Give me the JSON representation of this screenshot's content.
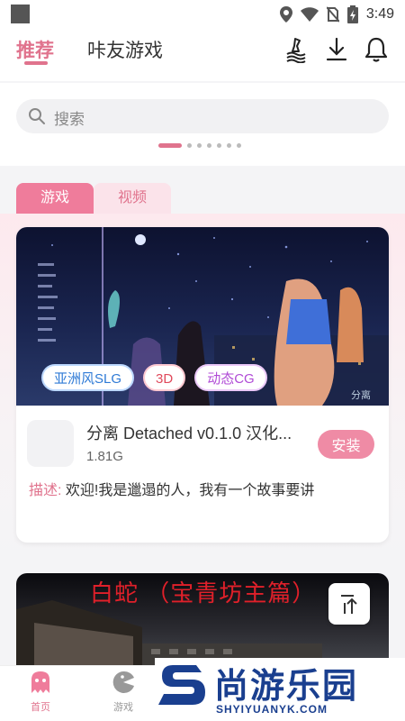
{
  "status_bar": {
    "time": "3:49",
    "icons": [
      "location-icon",
      "wifi-icon",
      "no-sim-icon",
      "battery-charging-icon"
    ]
  },
  "top_nav": {
    "tabs": [
      {
        "label": "推荐",
        "active": true
      },
      {
        "label": "咔友游戏",
        "active": false
      }
    ],
    "actions": [
      "wizard-icon",
      "download-icon",
      "bell-icon"
    ]
  },
  "search": {
    "placeholder": "搜索"
  },
  "carousel": {
    "active_index": 0,
    "dot_count": 8
  },
  "segment": {
    "tabs": [
      {
        "label": "游戏",
        "active": true
      },
      {
        "label": "视频",
        "active": false
      }
    ]
  },
  "game_card": {
    "tags": [
      "亚洲风SLG",
      "3D",
      "动态CG"
    ],
    "name": "分离 Detached v0.1.0 汉化...",
    "size": "1.81G",
    "install_label": "安装",
    "desc_label": "描述:",
    "desc_text": "欢迎!我是邋遢的人，我有一个故事要讲",
    "banner_watermark": "分离"
  },
  "second_card": {
    "title": "白蛇 （宝青坊主篇）"
  },
  "bottom_nav": {
    "items": [
      {
        "label": "首页",
        "active": true
      },
      {
        "label": "游戏",
        "active": false
      }
    ]
  },
  "watermark": {
    "text": "尚游乐园",
    "url": "SHYIYUANYK.COM"
  },
  "colors": {
    "accent": "#e0738d",
    "tag_blue": "#2e7ad6",
    "tag_red": "#e04a5c",
    "tag_purple": "#b04ad6"
  }
}
